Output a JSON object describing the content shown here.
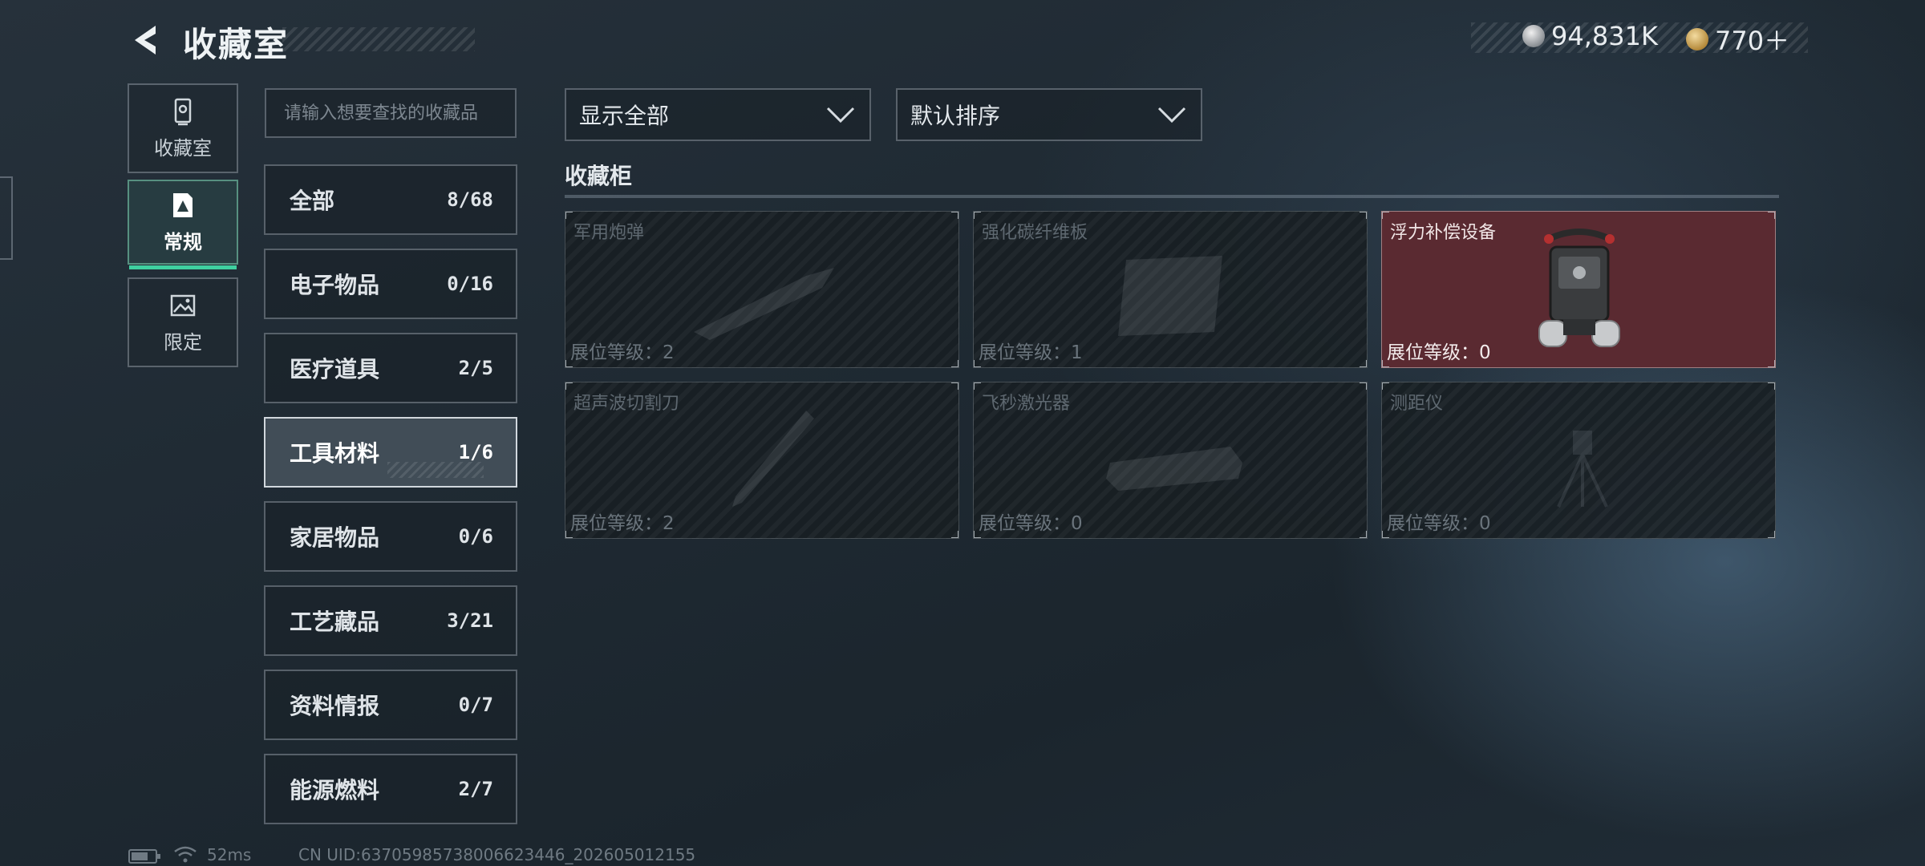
{
  "header": {
    "title": "收藏室",
    "currencies": [
      {
        "icon": "silver-coin-icon",
        "value": "94,831K"
      },
      {
        "icon": "gold-coin-icon",
        "value": "770＋"
      }
    ]
  },
  "side_nav": [
    {
      "label": "收藏室",
      "icon": "cabinet-icon",
      "active": false
    },
    {
      "label": "常规",
      "icon": "document-icon",
      "active": true
    },
    {
      "label": "限定",
      "icon": "image-icon",
      "active": false
    }
  ],
  "search": {
    "placeholder": "请输入想要查找的收藏品"
  },
  "categories": [
    {
      "name": "全部",
      "count": "8/68"
    },
    {
      "name": "电子物品",
      "count": "0/16"
    },
    {
      "name": "医疗道具",
      "count": "2/5"
    },
    {
      "name": "工具材料",
      "count": "1/6",
      "active": true
    },
    {
      "name": "家居物品",
      "count": "0/6"
    },
    {
      "name": "工艺藏品",
      "count": "3/21"
    },
    {
      "name": "资料情报",
      "count": "0/7"
    },
    {
      "name": "能源燃料",
      "count": "2/7"
    }
  ],
  "filters": {
    "show": "显示全部",
    "sort": "默认排序"
  },
  "cabinet": {
    "title": "收藏柜",
    "items": [
      {
        "name": "军用炮弹",
        "level": "展位等级：2",
        "owned": false
      },
      {
        "name": "强化碳纤维板",
        "level": "展位等级：1",
        "owned": false
      },
      {
        "name": "浮力补偿设备",
        "level": "展位等级：0",
        "owned": true
      },
      {
        "name": "超声波切割刀",
        "level": "展位等级：2",
        "owned": false
      },
      {
        "name": "飞秒激光器",
        "level": "展位等级：0",
        "owned": false
      },
      {
        "name": "测距仪",
        "level": "展位等级：0",
        "owned": false
      }
    ]
  },
  "status": {
    "ping": "52ms",
    "uid": "CN UID:63705985738006623446_202605012155"
  }
}
